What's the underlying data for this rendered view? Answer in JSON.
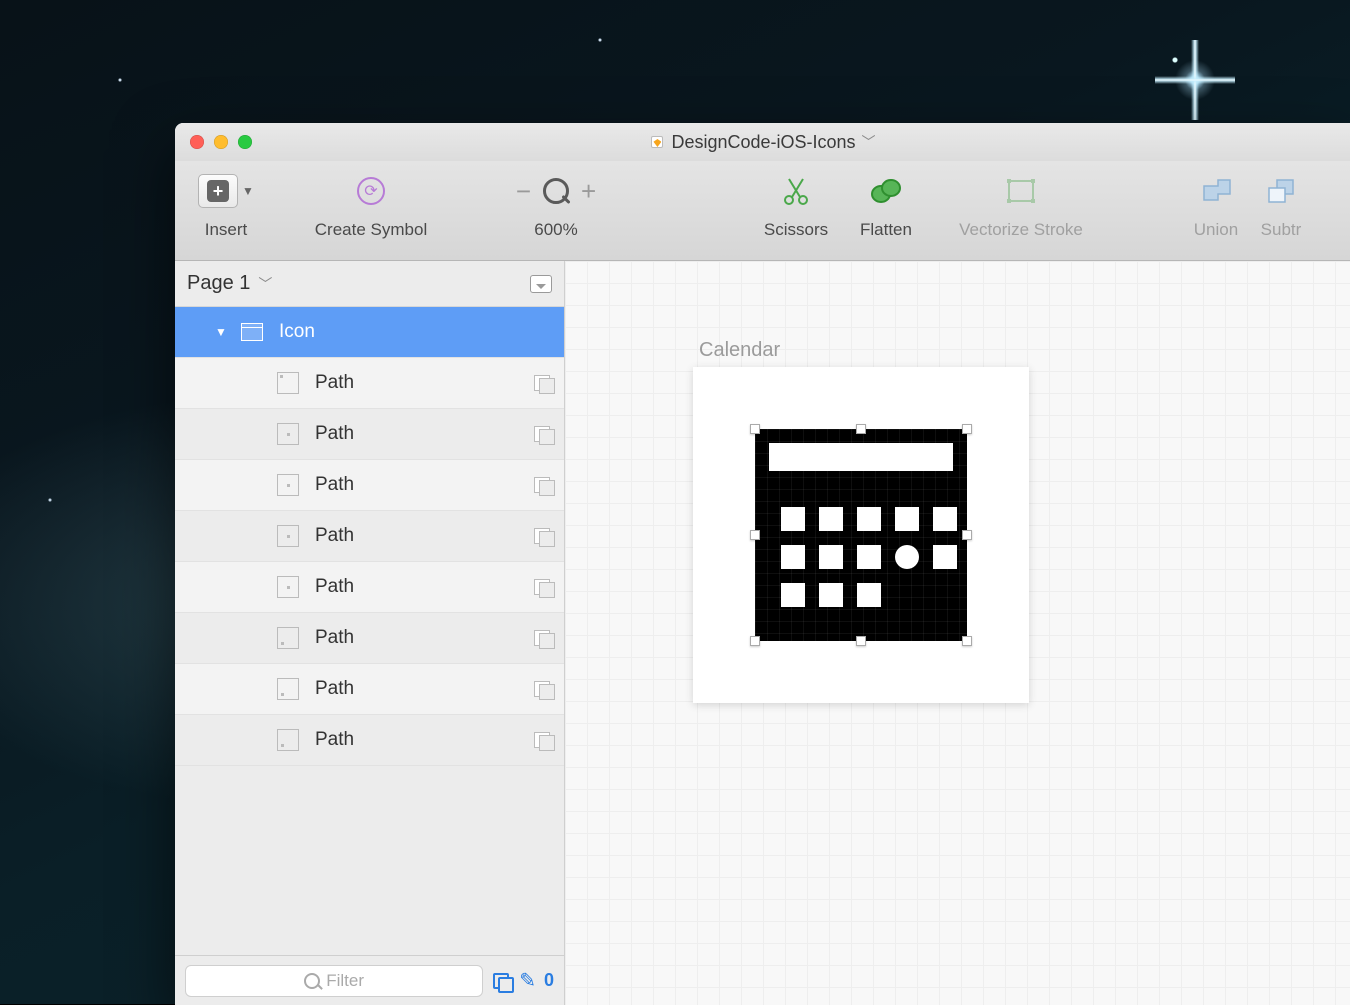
{
  "window": {
    "title": "DesignCode-iOS-Icons"
  },
  "toolbar": {
    "insert": "Insert",
    "create_symbol": "Create Symbol",
    "zoom": "600%",
    "scissors": "Scissors",
    "flatten": "Flatten",
    "vectorize": "Vectorize Stroke",
    "union": "Union",
    "subtract": "Subtr"
  },
  "sidebar": {
    "page": "Page 1",
    "layers": [
      {
        "name": "Icon",
        "type": "artboard",
        "selected": true
      },
      {
        "name": "Path",
        "type": "path"
      },
      {
        "name": "Path",
        "type": "path"
      },
      {
        "name": "Path",
        "type": "path"
      },
      {
        "name": "Path",
        "type": "path"
      },
      {
        "name": "Path",
        "type": "path"
      },
      {
        "name": "Path",
        "type": "path"
      },
      {
        "name": "Path",
        "type": "path"
      },
      {
        "name": "Path",
        "type": "path"
      }
    ],
    "filter_placeholder": "Filter",
    "slice_count": "0"
  },
  "canvas": {
    "artboard_label": "Calendar"
  }
}
